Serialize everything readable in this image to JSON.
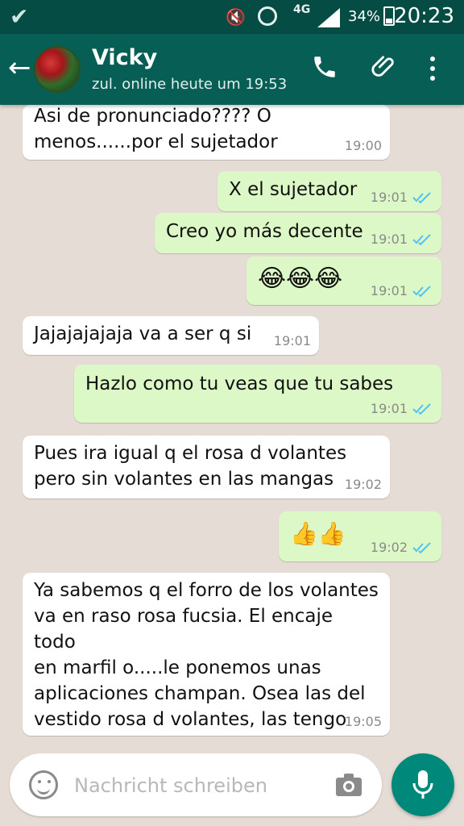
{
  "status_bar": {
    "time": "20:23",
    "battery": "34%",
    "network": "4G",
    "icons": [
      "check-icon",
      "mute-icon",
      "alarm-icon",
      "signal-icon",
      "battery-icon"
    ]
  },
  "header": {
    "name": "Vicky",
    "status": "zul. online heute um 19:53",
    "icons": [
      "back-arrow-icon",
      "avatar",
      "phone-icon",
      "attach-icon",
      "more-icon"
    ]
  },
  "messages": [
    {
      "direction": "incoming",
      "text": "Asi de pronunciado???? O\nmenos......por el sujetador",
      "time": "19:00"
    },
    {
      "direction": "outgoing",
      "text": "X el sujetador",
      "time": "19:01",
      "ticks": "double-blue"
    },
    {
      "direction": "outgoing",
      "text": "Creo yo más decente",
      "time": "19:01",
      "ticks": "double-blue"
    },
    {
      "direction": "outgoing",
      "text": "😂😂😂",
      "time": "19:01",
      "ticks": "double-blue"
    },
    {
      "direction": "incoming",
      "text": "Jajajajajaja va a ser q si",
      "time": "19:01"
    },
    {
      "direction": "outgoing",
      "text": "Hazlo como tu veas que tu sabes",
      "time": "19:01",
      "ticks": "double-blue"
    },
    {
      "direction": "incoming",
      "text": "Pues ira igual q el rosa d volantes\npero sin volantes en las mangas",
      "time": "19:02"
    },
    {
      "direction": "outgoing",
      "text": "👍👍",
      "time": "19:02",
      "ticks": "double-blue"
    },
    {
      "direction": "incoming",
      "text": "Ya sabemos q el forro de los volantes\nva en raso rosa fucsia. El encaje todo\nen marfil o.....le ponemos unas\naplicaciones champan. Osea las del\nvestido rosa d volantes, las tengo",
      "time": "19:05"
    }
  ],
  "composer": {
    "placeholder": "Nachricht schreiben",
    "icons": [
      "emoji-icon",
      "camera-icon",
      "mic-icon"
    ]
  },
  "colors": {
    "status_bar": "#054d44",
    "header": "#075e54",
    "chat_bg": "#e5ddd5",
    "incoming": "#ffffff",
    "outgoing": "#dcf8c6",
    "tick": "#4fc3f7",
    "mic": "#00897b"
  }
}
